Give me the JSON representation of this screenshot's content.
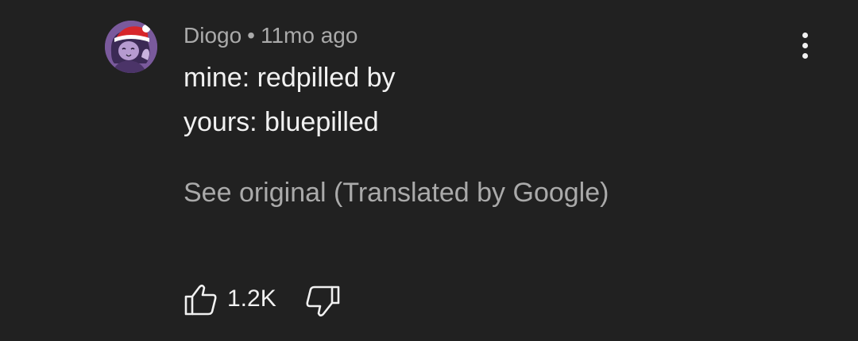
{
  "comment": {
    "author": "Diogo",
    "separator": "•",
    "time": "11mo ago",
    "body_lines": [
      "mine: redpilled by",
      "yours: bluepilled"
    ],
    "see_original": "See original (Translated by Google)",
    "like_count": "1.2K"
  },
  "icons": {
    "avatar": "avatar-image",
    "more": "more-vert-icon",
    "like": "thumb-up-icon",
    "dislike": "thumb-down-icon"
  },
  "colors": {
    "background": "#212121",
    "primary_text": "#f1f1f1",
    "secondary_text": "#aaaaaa"
  }
}
